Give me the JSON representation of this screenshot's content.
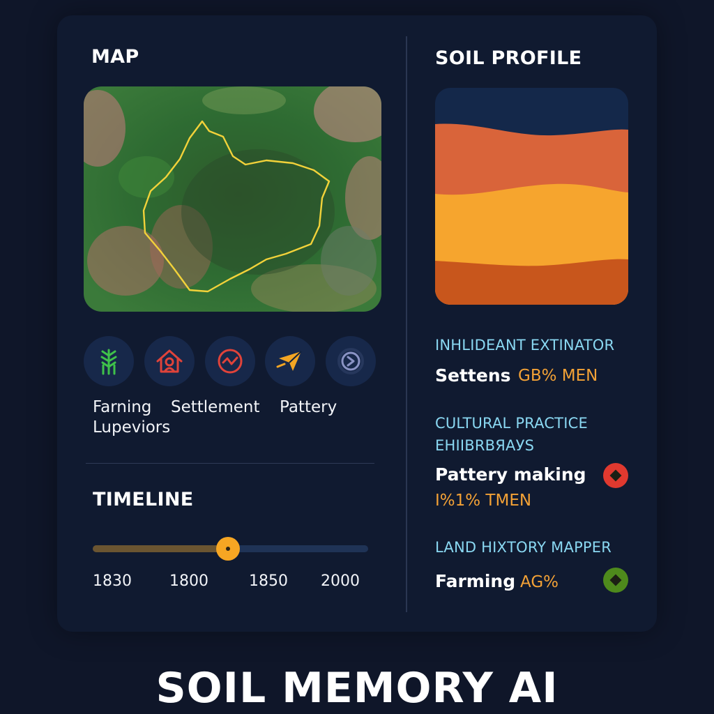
{
  "map": {
    "title": "MAP"
  },
  "activities": [
    {
      "icon": "farming-plant-icon",
      "color": "#3fc24a"
    },
    {
      "icon": "settlement-house-icon",
      "color": "#e0433a"
    },
    {
      "icon": "pottery-wave-icon",
      "color": "#e0433a"
    },
    {
      "icon": "plane-icon",
      "color": "#f3a523"
    },
    {
      "icon": "cycle-icon",
      "color": "#8a93c4"
    }
  ],
  "activity_labels": {
    "farming_line1": "Farning",
    "farming_line2": "Lupeviors",
    "settlement": "Settlement",
    "pottery": "Pattery"
  },
  "timeline": {
    "title": "TIMELINE",
    "ticks": [
      "1830",
      "1800",
      "1850",
      "2000"
    ],
    "position_fraction": 0.49
  },
  "soil_profile": {
    "title": "SOIL PROFILE",
    "layer_colors": [
      "#14284a",
      "#d9643a",
      "#f6a52e",
      "#c8561c"
    ]
  },
  "sections": {
    "extinator": {
      "label": "INHLIDEANT EXTINATOR",
      "name": "Settens",
      "value": "GB% MEN"
    },
    "cultural": {
      "label": "CULTURAL PRACTICE",
      "sublabel": "ЕНІІВRВЯАУS",
      "name": "Pattery making",
      "value": "I%1% TMEN",
      "badge_color": "#e0392f"
    },
    "land": {
      "label": "LAND НІХТОRY MAPPER",
      "name": "Farming",
      "value": "AG%",
      "badge_color": "#4e8a1c"
    }
  },
  "brand": {
    "title": "SOIL MEMORY AI"
  }
}
